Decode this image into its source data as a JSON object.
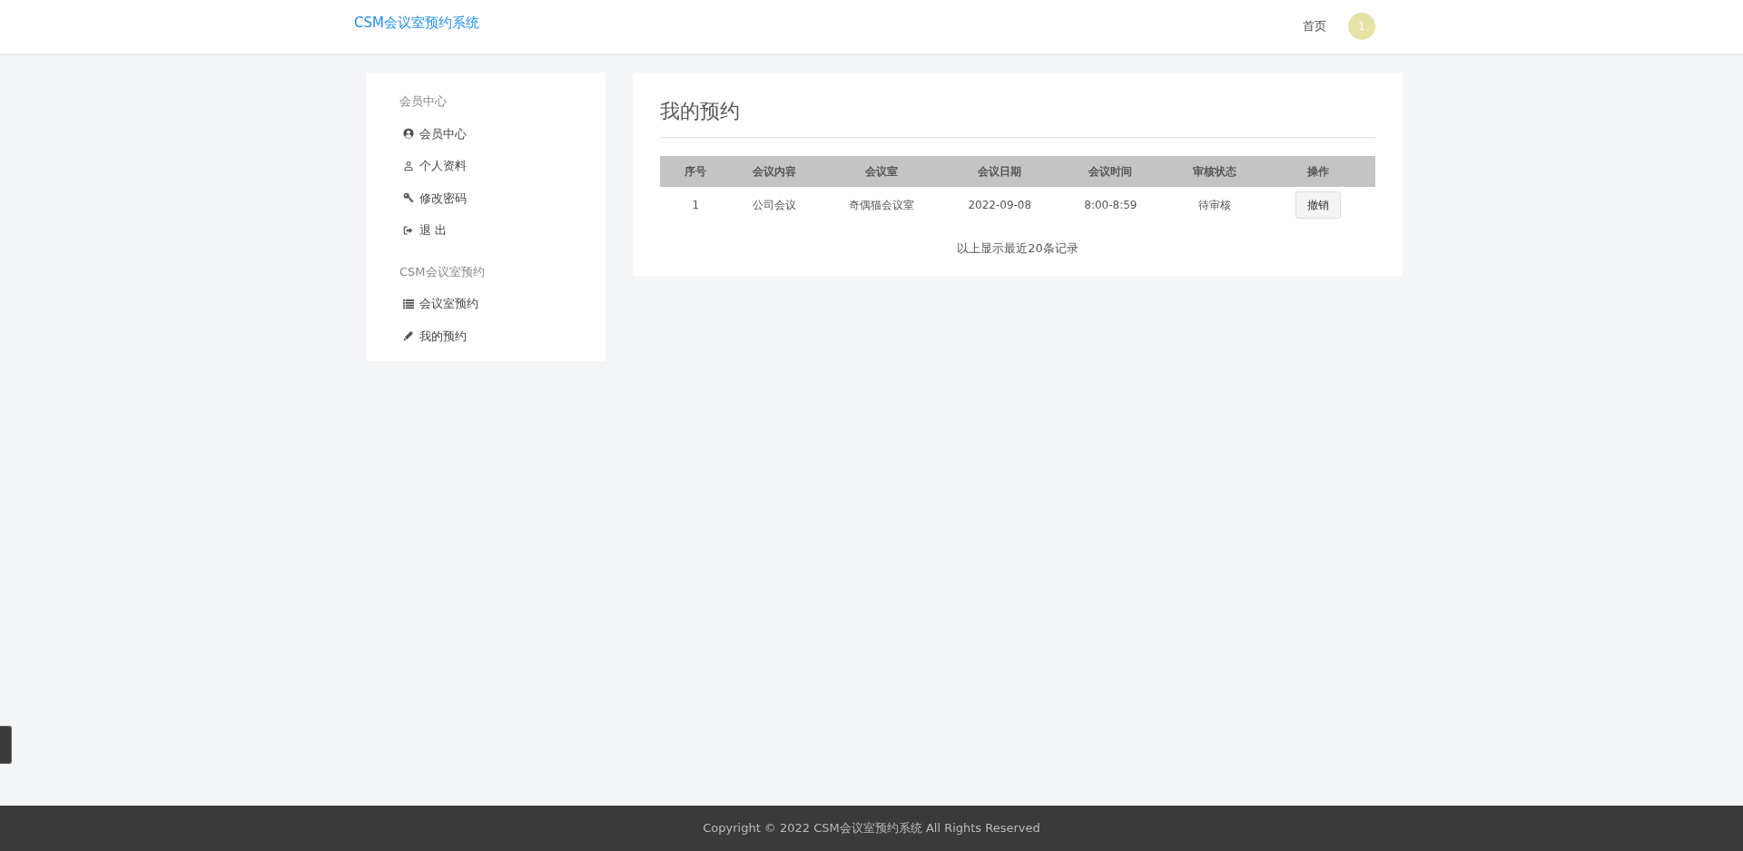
{
  "header": {
    "brand": "CSM会议室预约系统",
    "nav": [
      {
        "label": "首页"
      }
    ],
    "avatar": "1"
  },
  "sidebar": {
    "sections": [
      {
        "title": "会员中心",
        "items": [
          {
            "label": "会员中心",
            "kind": "user-circle"
          },
          {
            "label": "个人资料",
            "kind": "user"
          },
          {
            "label": "修改密码",
            "kind": "key"
          },
          {
            "label": "退 出",
            "kind": "sign-out"
          }
        ]
      },
      {
        "title": "CSM会议室预约",
        "items": [
          {
            "label": "会议室预约",
            "kind": "list"
          },
          {
            "label": "我的预约",
            "kind": "pencil"
          }
        ]
      }
    ]
  },
  "main": {
    "title": "我的预约",
    "table": {
      "columns": [
        "序号",
        "会议内容",
        "会议室",
        "会议日期",
        "会议时间",
        "审核状态",
        "操作"
      ],
      "rows": [
        {
          "cells": [
            "1",
            "公司会议",
            "奇偶猫会议室",
            "2022-09-08",
            "8:00-8:59",
            "待审核"
          ],
          "action": "撤销"
        }
      ]
    },
    "note": "以上显示最近20条记录"
  },
  "footer": "Copyright © 2022 CSM会议室预约系统 All Rights Reserved"
}
